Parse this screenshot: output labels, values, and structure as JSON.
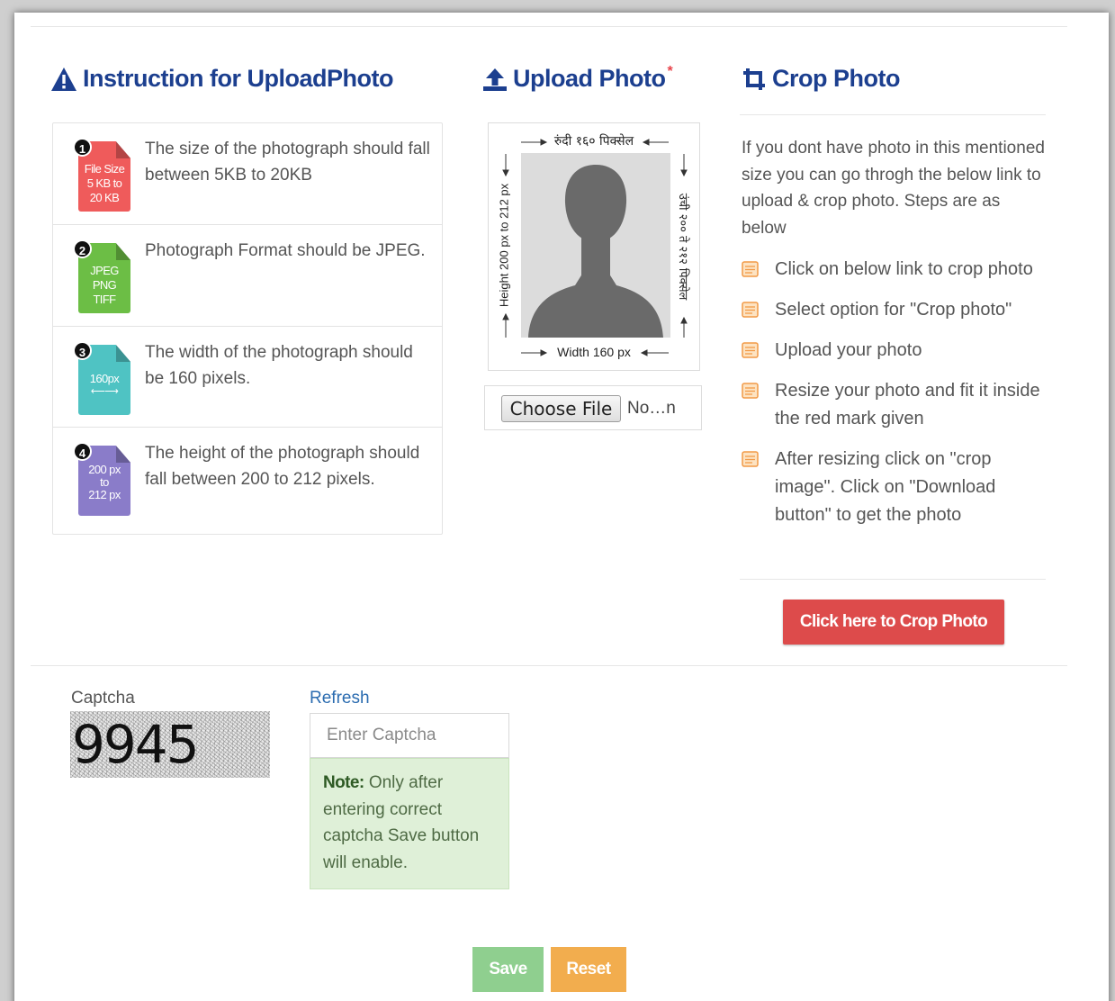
{
  "instructions": {
    "title": "Instruction for UploadPhoto",
    "items": [
      {
        "number": "1",
        "badge_lines": [
          "File Size",
          "5 KB to",
          "20 KB"
        ],
        "badge_color": "#ef5b5b",
        "text": "The size of the photograph should fall between 5KB to 20KB"
      },
      {
        "number": "2",
        "badge_lines": [
          "JPEG",
          "PNG",
          "TIFF"
        ],
        "badge_color": "#6cbe45",
        "text": "Photograph Format should be JPEG."
      },
      {
        "number": "3",
        "badge_lines": [
          "160px"
        ],
        "badge_color": "#4fc3c3",
        "text": "The width of the photograph should be 160 pixels."
      },
      {
        "number": "4",
        "badge_lines": [
          "200 px",
          "to",
          "212 px"
        ],
        "badge_color": "#8a7cc9",
        "text": "The height of the photograph should fall between 200 to 212 pixels."
      }
    ]
  },
  "upload": {
    "title": "Upload Photo",
    "required_mark": "*",
    "top_label": "रुंदी १६० पिक्सेल",
    "bottom_label": "Width 160 px",
    "left_label": "Height 200 px to 212 px",
    "right_label": "उंची २०० ते २१२ पिक्सेल",
    "choose_file_label": "Choose File",
    "file_status": "No…n"
  },
  "crop": {
    "title": "Crop Photo",
    "intro": "If you dont have photo in this mentioned size you can go throgh the below link to upload & crop photo. Steps are as below",
    "steps": [
      "Click on below link to crop photo",
      "Select option for \"Crop photo\"",
      "Upload your photo",
      "Resize your photo and fit it inside the red mark given",
      "After resizing click on \"crop image\". Click on \"Download button\" to get the photo"
    ],
    "button_label": "Click here to Crop Photo"
  },
  "captcha": {
    "label": "Captcha",
    "code": "9945",
    "refresh_label": "Refresh",
    "input_placeholder": "Enter Captcha",
    "note_label": "Note:",
    "note_text": " Only after entering correct captcha Save button will enable."
  },
  "actions": {
    "save_label": "Save",
    "reset_label": "Reset"
  },
  "colors": {
    "title_blue": "#1c3f8f",
    "crop_button": "#dd4b4b",
    "save_button": "#8fcf8f",
    "reset_button": "#f2ad4e",
    "note_bg": "#dff0d8"
  }
}
